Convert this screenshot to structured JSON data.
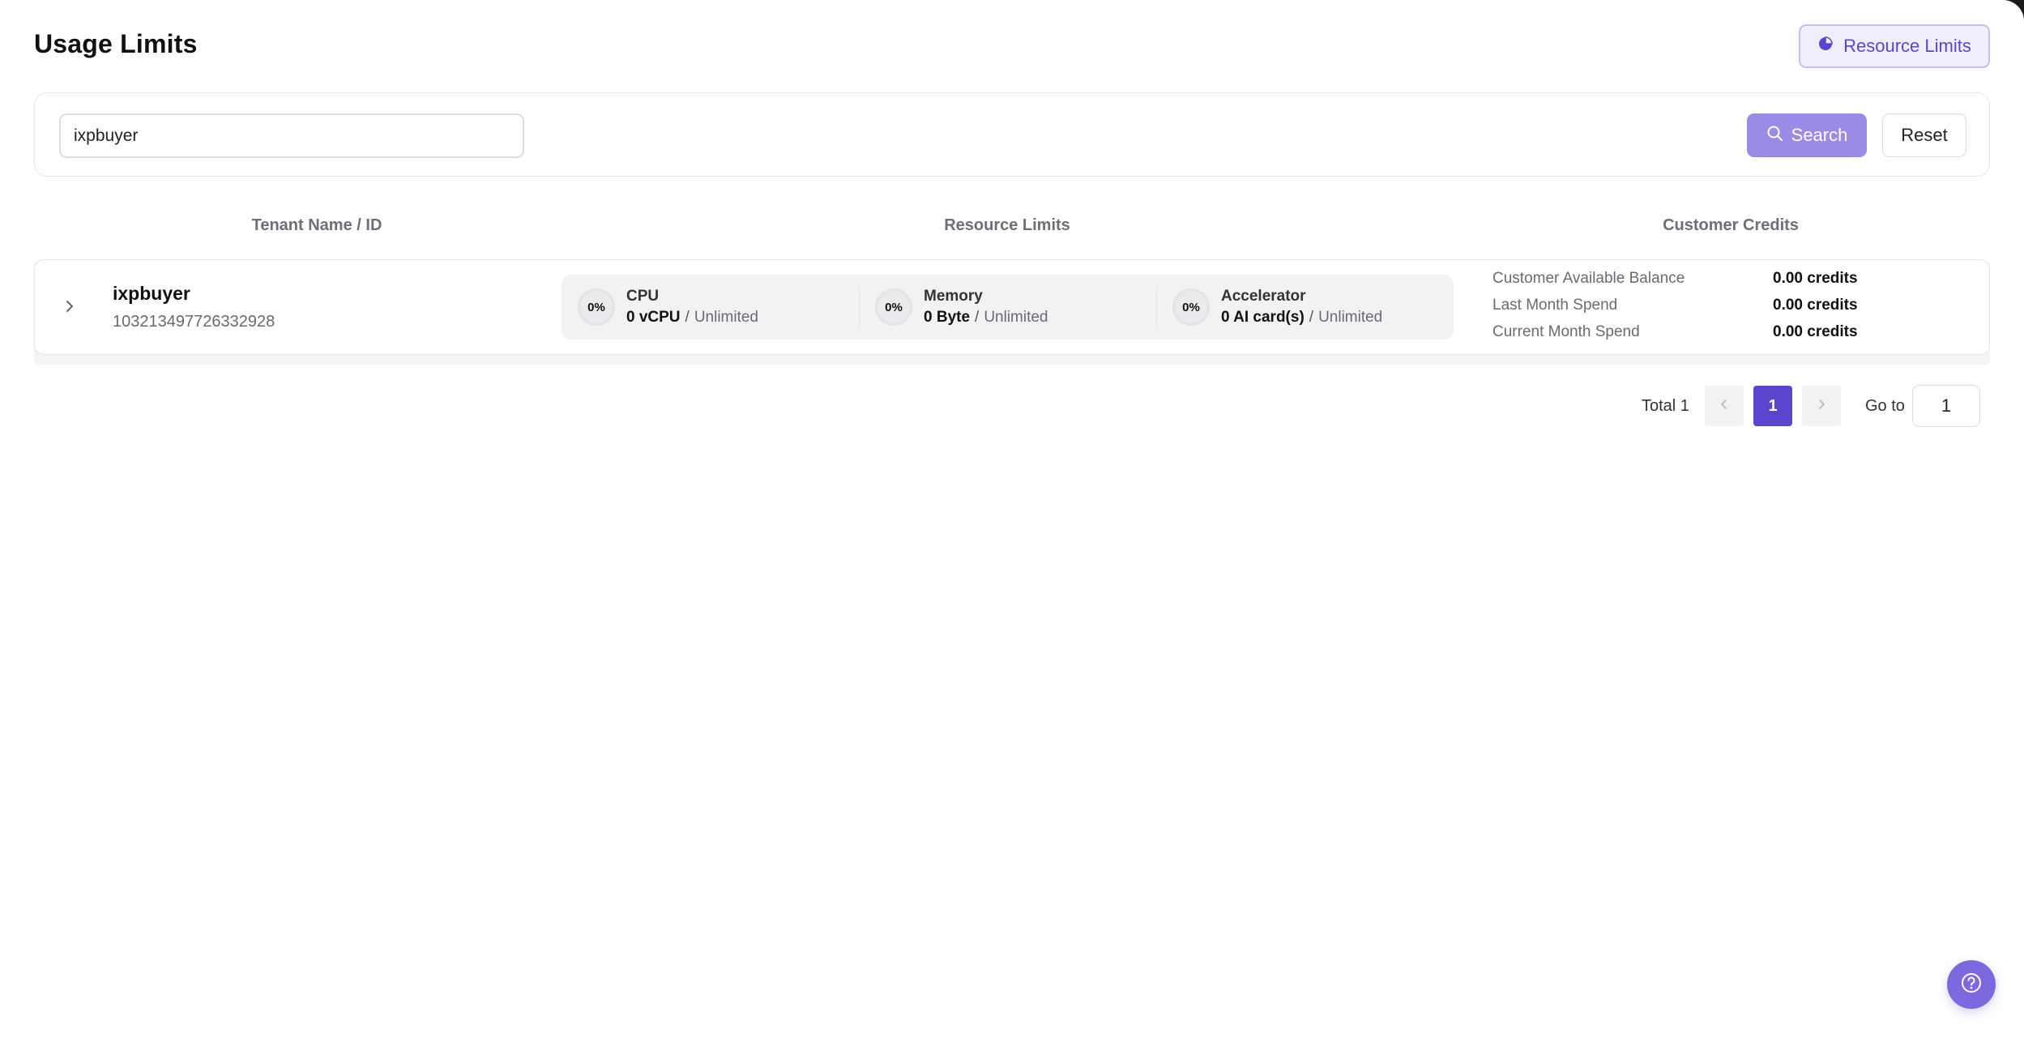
{
  "page": {
    "title": "Usage Limits"
  },
  "header": {
    "resource_limits_label": "Resource Limits"
  },
  "search": {
    "value": "ixpbuyer",
    "search_label": "Search",
    "reset_label": "Reset"
  },
  "table": {
    "columns": [
      "Tenant Name / ID",
      "Resource Limits",
      "Customer Credits"
    ],
    "rows": [
      {
        "name": "ixpbuyer",
        "id": "103213497726332928",
        "resources": [
          {
            "percent": "0%",
            "label": "CPU",
            "used": "0 vCPU",
            "separator": "/",
            "limit": "Unlimited"
          },
          {
            "percent": "0%",
            "label": "Memory",
            "used": "0 Byte",
            "separator": "/",
            "limit": "Unlimited"
          },
          {
            "percent": "0%",
            "label": "Accelerator",
            "used": "0 AI card(s)",
            "separator": "/",
            "limit": "Unlimited"
          }
        ],
        "credits": [
          {
            "label": "Customer Available Balance",
            "value": "0.00 credits"
          },
          {
            "label": "Last Month Spend",
            "value": "0.00 credits"
          },
          {
            "label": "Current Month Spend",
            "value": "0.00 credits"
          }
        ]
      }
    ]
  },
  "pagination": {
    "total_label": "Total 1",
    "current_page": "1",
    "goto_label": "Go to",
    "goto_value": "1"
  },
  "icons": {
    "resource": "pie-chart-icon",
    "search": "search-icon",
    "expand": "chevron-right-icon",
    "prev": "chevron-left-icon",
    "next": "chevron-right-icon",
    "help": "help-circle-icon"
  },
  "colors": {
    "accent": "#5b45cc",
    "accent_light": "#9b8ae6",
    "help": "#7d68e0"
  }
}
